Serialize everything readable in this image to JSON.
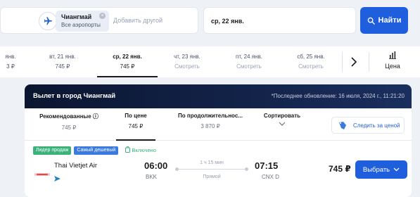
{
  "search": {
    "chip_title": "Чиангмай",
    "chip_subtitle": "Все аэропорты",
    "chip_close": "×",
    "add_other_placeholder": "Добавить другой",
    "date_value": "ср, 22 янв.",
    "find_label": "Найти"
  },
  "dates": [
    {
      "day": "янв.",
      "price": "3 ₽"
    },
    {
      "day": "вт, 21 янв.",
      "price": "745 ₽"
    },
    {
      "day": "ср, 22 янв.",
      "price": "745 ₽"
    },
    {
      "day": "чт, 23 янв.",
      "price": "Смотреть"
    },
    {
      "day": "пт, 24 янв.",
      "price": "Смотреть"
    },
    {
      "day": "сб, 25 янв.",
      "price": "Смотреть"
    }
  ],
  "price_view_label": "Цена",
  "results": {
    "title": "Вылет в город Чиангмай",
    "updated": "*Последнее обновление: 16 июля, 2024 г., 11:21:20",
    "sorts": [
      {
        "label": "Рекомендованные ⓘ",
        "value": "745 ₽"
      },
      {
        "label": "По цене",
        "value": "745 ₽"
      },
      {
        "label": "По продолжительнос...",
        "value": "3 870 ₽"
      },
      {
        "label": "Сортировать",
        "value": ""
      }
    ],
    "follow_label": "Следить за ценой",
    "badges": [
      "Лидер продаж",
      "Самый дешевый"
    ],
    "included_label": "Включено",
    "flight": {
      "airline": "Thai Vietjet Air",
      "dep_time": "06:00",
      "dep_code": "BKK",
      "duration": "1 ч 15 мин",
      "type": "Прямой",
      "arr_time": "07:15",
      "arr_code": "CNX D",
      "price": "745 ₽",
      "select_label": "Выбрать"
    }
  },
  "colors": {
    "accent": "#1f5fde",
    "header_dark": "#0b1630",
    "badge_green": "#3bb27a",
    "badge_blue": "#3b7ae0"
  }
}
